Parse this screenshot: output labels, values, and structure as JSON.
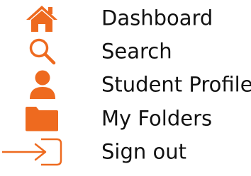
{
  "accent_color": "#ee6a1f",
  "menu": {
    "items": [
      {
        "label": "Dashboard",
        "icon": "home-icon"
      },
      {
        "label": "Search",
        "icon": "search-icon"
      },
      {
        "label": "Student Profile",
        "icon": "user-icon"
      },
      {
        "label": "My Folders",
        "icon": "folder-icon"
      },
      {
        "label": "Sign out",
        "icon": "sign-out-icon"
      }
    ]
  }
}
